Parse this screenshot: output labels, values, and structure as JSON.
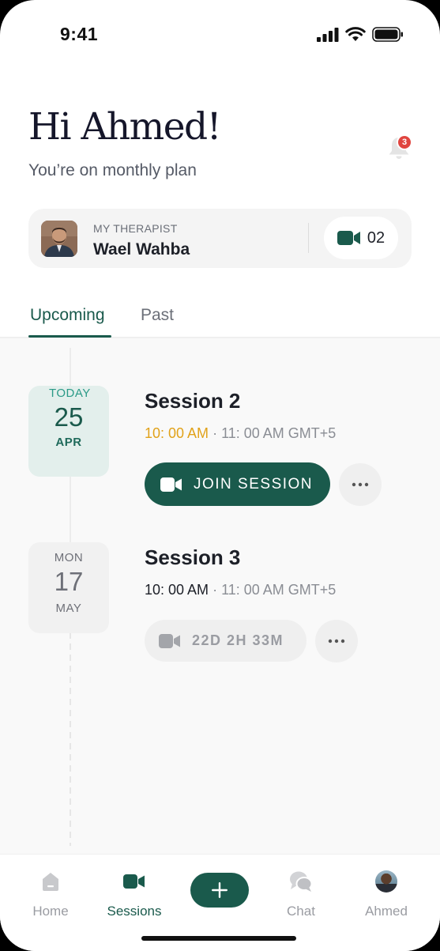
{
  "status_bar": {
    "time": "9:41"
  },
  "header": {
    "greeting": "Hi Ahmed!",
    "plan": "You’re on monthly plan",
    "notification_count": "3"
  },
  "therapist": {
    "label": "MY THERAPIST",
    "name": "Wael Wahba",
    "session_count": "02"
  },
  "tabs": [
    {
      "label": "Upcoming",
      "active": true
    },
    {
      "label": "Past",
      "active": false
    }
  ],
  "sessions": [
    {
      "day_of_week": "TODAY",
      "day": "25",
      "month": "APR",
      "title": "Session 2",
      "start": "10: 00 AM",
      "end": "· 11: 00 AM GMT+5",
      "action": "JOIN SESSION"
    },
    {
      "day_of_week": "MON",
      "day": "17",
      "month": "MAY",
      "title": "Session 3",
      "start": "10: 00 AM",
      "end": "· 11: 00 AM GMT+5",
      "action": "22D 2H 33M"
    }
  ],
  "bottom_nav": [
    {
      "label": "Home",
      "icon": "home-icon"
    },
    {
      "label": "Sessions",
      "icon": "video-camera-icon",
      "active": true
    },
    {
      "label": "Chat",
      "icon": "chat-icon"
    },
    {
      "label": "Ahmed",
      "icon": "avatar"
    }
  ],
  "colors": {
    "brand": "#1a5a4c",
    "accent_time": "#e1a21a",
    "badge": "#e0453f"
  }
}
